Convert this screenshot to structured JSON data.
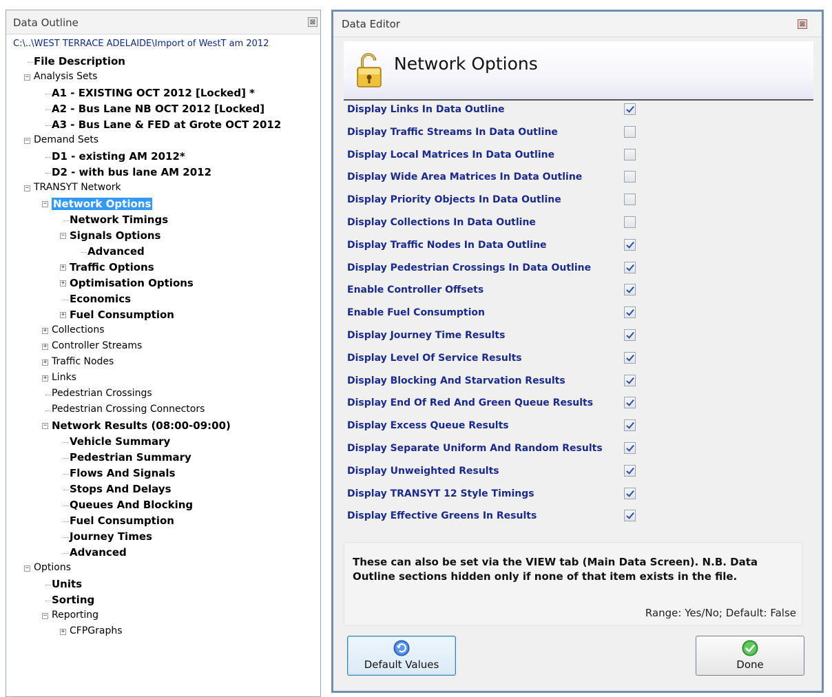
{
  "outline": {
    "title": "Data Outline",
    "path": "C:\\..\\WEST TERRACE ADELAIDE\\Import of WestT am  2012",
    "nodes": [
      {
        "label": "File Description",
        "bold": true,
        "indent": 0
      },
      {
        "label": "Analysis Sets",
        "expander": "-",
        "indent": 0
      },
      {
        "label": "A1 - EXISTING OCT 2012 [Locked] *",
        "bold": true,
        "indent": 1
      },
      {
        "label": "A2 - Bus Lane NB OCT 2012 [Locked]",
        "bold": true,
        "indent": 1
      },
      {
        "label": "A3 - Bus Lane & FED at Grote OCT 2012",
        "bold": true,
        "indent": 1
      },
      {
        "label": "Demand Sets",
        "expander": "-",
        "indent": 0
      },
      {
        "label": "D1 - existing AM 2012*",
        "bold": true,
        "indent": 1
      },
      {
        "label": "D2 - with bus lane  AM 2012",
        "bold": true,
        "indent": 1
      },
      {
        "label": "TRANSYT Network",
        "expander": "-",
        "indent": 0
      },
      {
        "label": "Network Options",
        "bold": true,
        "expander": "-",
        "indent": 1,
        "selected": true
      },
      {
        "label": "Network Timings",
        "bold": true,
        "indent": 2
      },
      {
        "label": "Signals Options",
        "bold": true,
        "expander": "-",
        "indent": 2
      },
      {
        "label": "Advanced",
        "bold": true,
        "indent": 3
      },
      {
        "label": "Traffic Options",
        "bold": true,
        "expander": "+",
        "indent": 2
      },
      {
        "label": "Optimisation Options",
        "bold": true,
        "expander": "+",
        "indent": 2
      },
      {
        "label": "Economics",
        "bold": true,
        "indent": 2
      },
      {
        "label": "Fuel Consumption",
        "bold": true,
        "expander": "+",
        "indent": 2
      },
      {
        "label": "Collections",
        "expander": "+",
        "indent": 1
      },
      {
        "label": "Controller Streams",
        "expander": "+",
        "indent": 1
      },
      {
        "label": "Traffic Nodes",
        "expander": "+",
        "indent": 1
      },
      {
        "label": "Links",
        "expander": "+",
        "indent": 1
      },
      {
        "label": "Pedestrian Crossings",
        "indent": 1
      },
      {
        "label": "Pedestrian Crossing Connectors",
        "indent": 1
      },
      {
        "label": "Network Results (08:00-09:00)",
        "bold": true,
        "expander": "-",
        "indent": 1
      },
      {
        "label": "Vehicle Summary",
        "bold": true,
        "indent": 2
      },
      {
        "label": "Pedestrian Summary",
        "bold": true,
        "indent": 2
      },
      {
        "label": "Flows And Signals",
        "bold": true,
        "indent": 2
      },
      {
        "label": "Stops And Delays",
        "bold": true,
        "indent": 2
      },
      {
        "label": "Queues And Blocking",
        "bold": true,
        "indent": 2
      },
      {
        "label": "Fuel Consumption",
        "bold": true,
        "indent": 2
      },
      {
        "label": "Journey Times",
        "bold": true,
        "indent": 2
      },
      {
        "label": "Advanced",
        "bold": true,
        "indent": 2
      },
      {
        "label": "Options",
        "expander": "-",
        "indent": 0
      },
      {
        "label": "Units",
        "bold": true,
        "indent": 1
      },
      {
        "label": "Sorting",
        "bold": true,
        "indent": 1
      },
      {
        "label": "Reporting",
        "expander": "-",
        "indent": 1
      },
      {
        "label": "CFPGraphs",
        "expander": "+",
        "indent": 2
      }
    ]
  },
  "editor": {
    "title": "Data Editor",
    "banner_title": "Network Options",
    "options": [
      {
        "label": "Display Links In Data Outline",
        "checked": true
      },
      {
        "label": "Display Traffic Streams In Data Outline",
        "checked": false
      },
      {
        "label": "Display Local Matrices In Data Outline",
        "checked": false
      },
      {
        "label": "Display Wide Area Matrices In Data Outline",
        "checked": false
      },
      {
        "label": "Display Priority Objects In Data Outline",
        "checked": false
      },
      {
        "label": "Display Collections In Data Outline",
        "checked": false
      },
      {
        "label": "Display Traffic Nodes In Data Outline",
        "checked": true
      },
      {
        "label": "Display Pedestrian Crossings In Data Outline",
        "checked": true
      },
      {
        "label": "Enable Controller Offsets",
        "checked": true
      },
      {
        "label": "Enable Fuel Consumption",
        "checked": true
      },
      {
        "label": "Display Journey Time Results",
        "checked": true
      },
      {
        "label": "Display Level Of Service Results",
        "checked": true
      },
      {
        "label": "Display Blocking And Starvation Results",
        "checked": true
      },
      {
        "label": "Display End Of Red And Green Queue Results",
        "checked": true
      },
      {
        "label": "Display Excess Queue Results",
        "checked": true
      },
      {
        "label": "Display Separate Uniform And Random Results",
        "checked": true
      },
      {
        "label": "Display Unweighted Results",
        "checked": true
      },
      {
        "label": "Display TRANSYT 12 Style Timings",
        "checked": true
      },
      {
        "label": "Display Effective Greens In Results",
        "checked": true
      }
    ],
    "help_text": "These can also be set via the VIEW tab (Main Data Screen). N.B. Data Outline sections hidden only if none of that item exists in the file.",
    "range_text": "Range: Yes/No; Default: False",
    "buttons": {
      "default_label": "Default Values",
      "done_label": "Done"
    }
  },
  "icons": [
    "close-icon",
    "lock-icon",
    "undo-icon",
    "check-icon"
  ],
  "colors": {
    "option_label": "#1a2a8f",
    "selection": "#3399ff",
    "editor_border": "#6f8fb3"
  }
}
